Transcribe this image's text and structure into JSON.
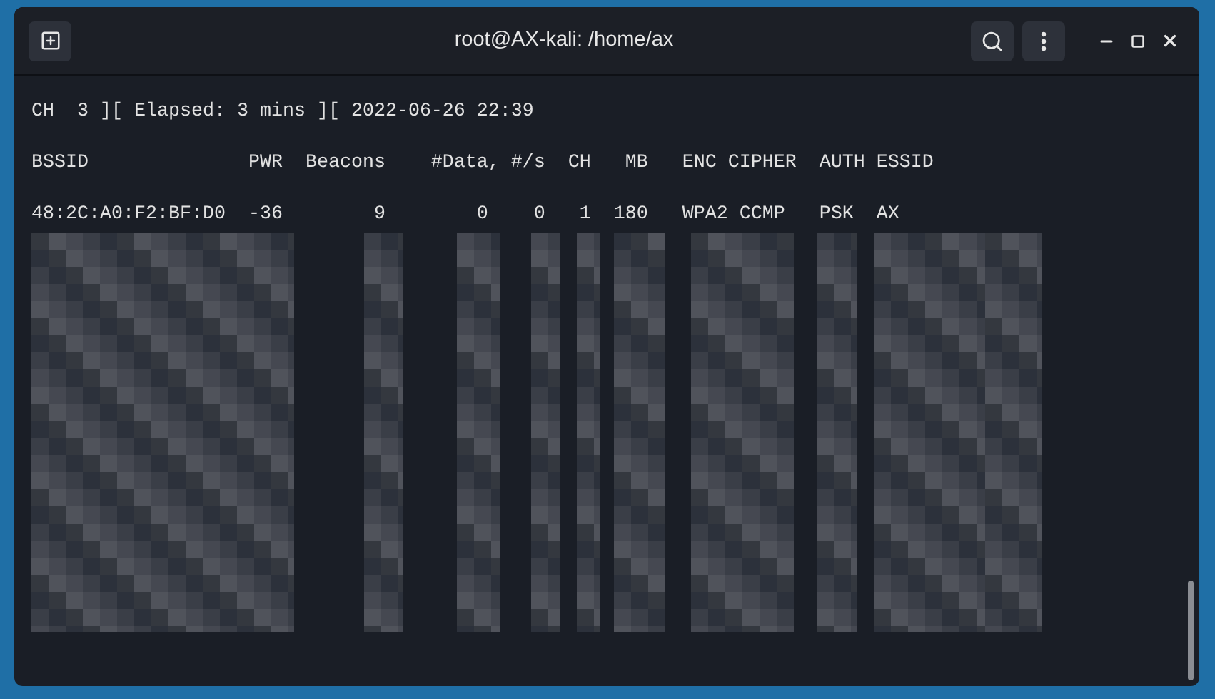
{
  "window": {
    "title": "root@AX-kali: /home/ax"
  },
  "terminal": {
    "lines": [
      "CH  3 ][ Elapsed: 3 mins ][ 2022-06-26 22:39",
      "BSSID              PWR  Beacons    #Data, #/s  CH   MB   ENC CIPHER  AUTH ESSID",
      "48:2C:A0:F2:BF:D0  -36        9        0    0   1  180   WPA2 CCMP   PSK  AX"
    ]
  }
}
